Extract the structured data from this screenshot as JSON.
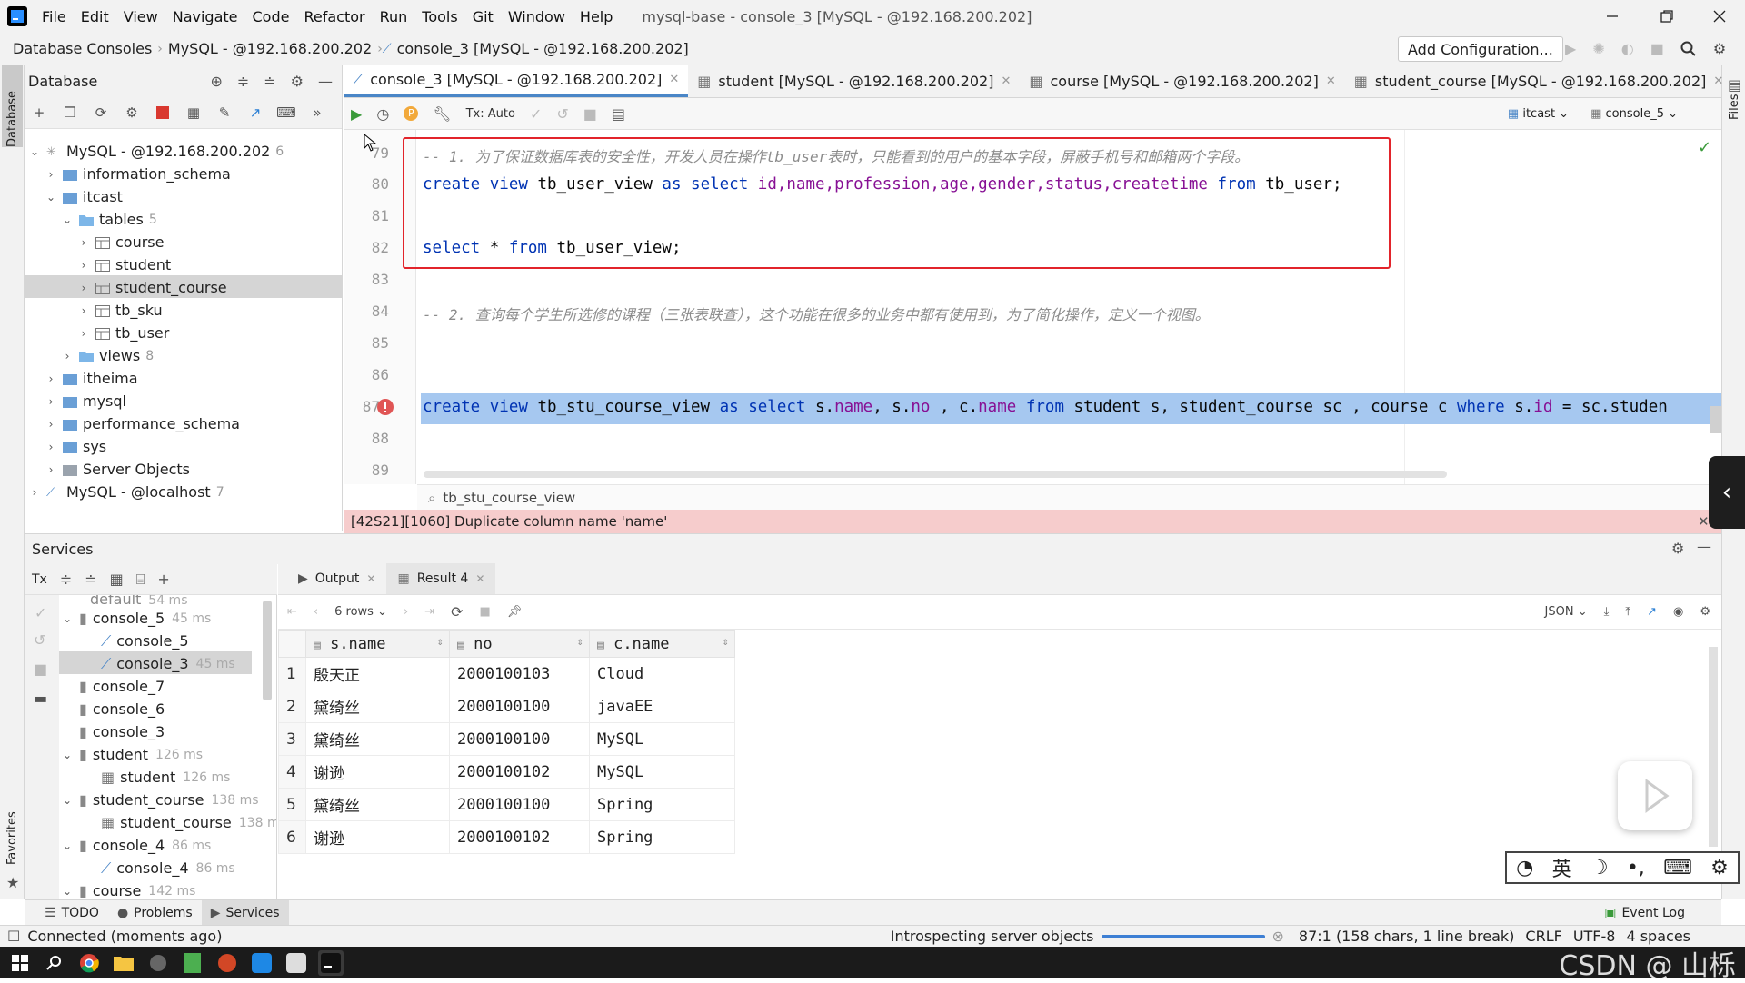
{
  "menubar": {
    "items": [
      "File",
      "Edit",
      "View",
      "Navigate",
      "Code",
      "Refactor",
      "Run",
      "Tools",
      "Git",
      "Window",
      "Help"
    ],
    "title": "mysql-base - console_3 [MySQL - @192.168.200.202]"
  },
  "navbar": {
    "breadcrumbs": [
      "Database Consoles",
      "MySQL - @192.168.200.202",
      "console_3 [MySQL - @192.168.200.202]"
    ],
    "add_config": "Add Configuration..."
  },
  "left_stripe": {
    "database": "Database",
    "favorites": "Favorites"
  },
  "right_stripe": {
    "files": "Files"
  },
  "db_panel": {
    "title": "Database",
    "tree": [
      {
        "label": "MySQL - @192.168.200.202",
        "count": "6"
      },
      {
        "label": "information_schema"
      },
      {
        "label": "itcast"
      },
      {
        "label": "tables",
        "count": "5"
      },
      {
        "label": "course"
      },
      {
        "label": "student"
      },
      {
        "label": "student_course"
      },
      {
        "label": "tb_sku"
      },
      {
        "label": "tb_user"
      },
      {
        "label": "views",
        "count": "8"
      },
      {
        "label": "itheima"
      },
      {
        "label": "mysql"
      },
      {
        "label": "performance_schema"
      },
      {
        "label": "sys"
      },
      {
        "label": "Server Objects"
      },
      {
        "label": "MySQL - @localhost",
        "count": "7"
      }
    ]
  },
  "editor": {
    "tabs": [
      "console_3 [MySQL - @192.168.200.202]",
      "student [MySQL - @192.168.200.202]",
      "course [MySQL - @192.168.200.202]",
      "student_course [MySQL - @192.168.200.202]"
    ],
    "tx_mode": "Tx: Auto",
    "schema": "itcast",
    "session": "console_5",
    "line_numbers": [
      "79",
      "80",
      "81",
      "82",
      "83",
      "84",
      "85",
      "86",
      "87",
      "88",
      "89"
    ],
    "line79": "-- 1. 为了保证数据库表的安全性，开发人员在操作tb_user表时，只能看到的用户的基本字段，屏蔽手机号和邮箱两个字段。",
    "line80": {
      "kw1": "create view",
      "name": " tb_user_view ",
      "kw2": "as select",
      "cols": " id,name,profession,age,gender,status,createtime ",
      "kw3": "from",
      "tbl": " tb_user;"
    },
    "line82": {
      "kw1": "select",
      "star": " * ",
      "kw2": "from",
      "tbl": " tb_user_view;"
    },
    "line84": "-- 2. 查询每个学生所选修的课程（三张表联查），这个功能在很多的业务中都有使用到，为了简化操作，定义一个视图。",
    "line87": {
      "kw1": "create view",
      "name": " tb_stu_course_view ",
      "kw2": "as select",
      "a": " s.",
      "c1": "name",
      "b": ", s.",
      "c2": "no",
      "c": " , c.",
      "c3": "name",
      "d": " ",
      "kw3": "from",
      "e": " student s, student_course sc , course c ",
      "kw4": "where",
      "f": " s.",
      "c4": "id",
      "g": " = sc.studen"
    },
    "breadcrumb": "tb_stu_course_view",
    "error": "[42S21][1060] Duplicate column name 'name'"
  },
  "services": {
    "title": "Services",
    "tree": [
      {
        "label": "default",
        "ms": "54 ms"
      },
      {
        "label": "console_5",
        "ms": "45 ms"
      },
      {
        "label": "console_5",
        "ms": ""
      },
      {
        "label": "console_3",
        "ms": "45 ms"
      },
      {
        "label": "console_7",
        "ms": ""
      },
      {
        "label": "console_6",
        "ms": ""
      },
      {
        "label": "console_3",
        "ms": ""
      },
      {
        "label": "student",
        "ms": "126 ms"
      },
      {
        "label": "student",
        "ms": "126 ms"
      },
      {
        "label": "student_course",
        "ms": "138 ms"
      },
      {
        "label": "student_course",
        "ms": "138 ms"
      },
      {
        "label": "console_4",
        "ms": "86 ms"
      },
      {
        "label": "console_4",
        "ms": "86 ms"
      },
      {
        "label": "course",
        "ms": "142 ms"
      }
    ],
    "result_tabs": [
      "Output",
      "Result 4"
    ],
    "rows_label": "6 rows",
    "format": "JSON",
    "columns": [
      "s.name",
      "no",
      "c.name"
    ],
    "rows": [
      [
        "1",
        "殷天正",
        "2000100103",
        "Cloud"
      ],
      [
        "2",
        "黛绮丝",
        "2000100100",
        "javaEE"
      ],
      [
        "3",
        "黛绮丝",
        "2000100100",
        "MySQL"
      ],
      [
        "4",
        "谢逊",
        "2000100102",
        "MySQL"
      ],
      [
        "5",
        "黛绮丝",
        "2000100100",
        "Spring"
      ],
      [
        "6",
        "谢逊",
        "2000100102",
        "Spring"
      ]
    ]
  },
  "bottom_tabs": [
    "TODO",
    "Problems",
    "Services"
  ],
  "event_log": "Event Log",
  "status": {
    "left": "Connected (moments ago)",
    "middle": "Introspecting server objects",
    "position": "87:1 (158 chars, 1 line break)",
    "crlf": "CRLF",
    "encoding": "UTF-8",
    "indent": "4 spaces"
  },
  "ime": {
    "lang": "英"
  },
  "watermark": "CSDN @ 山栎"
}
